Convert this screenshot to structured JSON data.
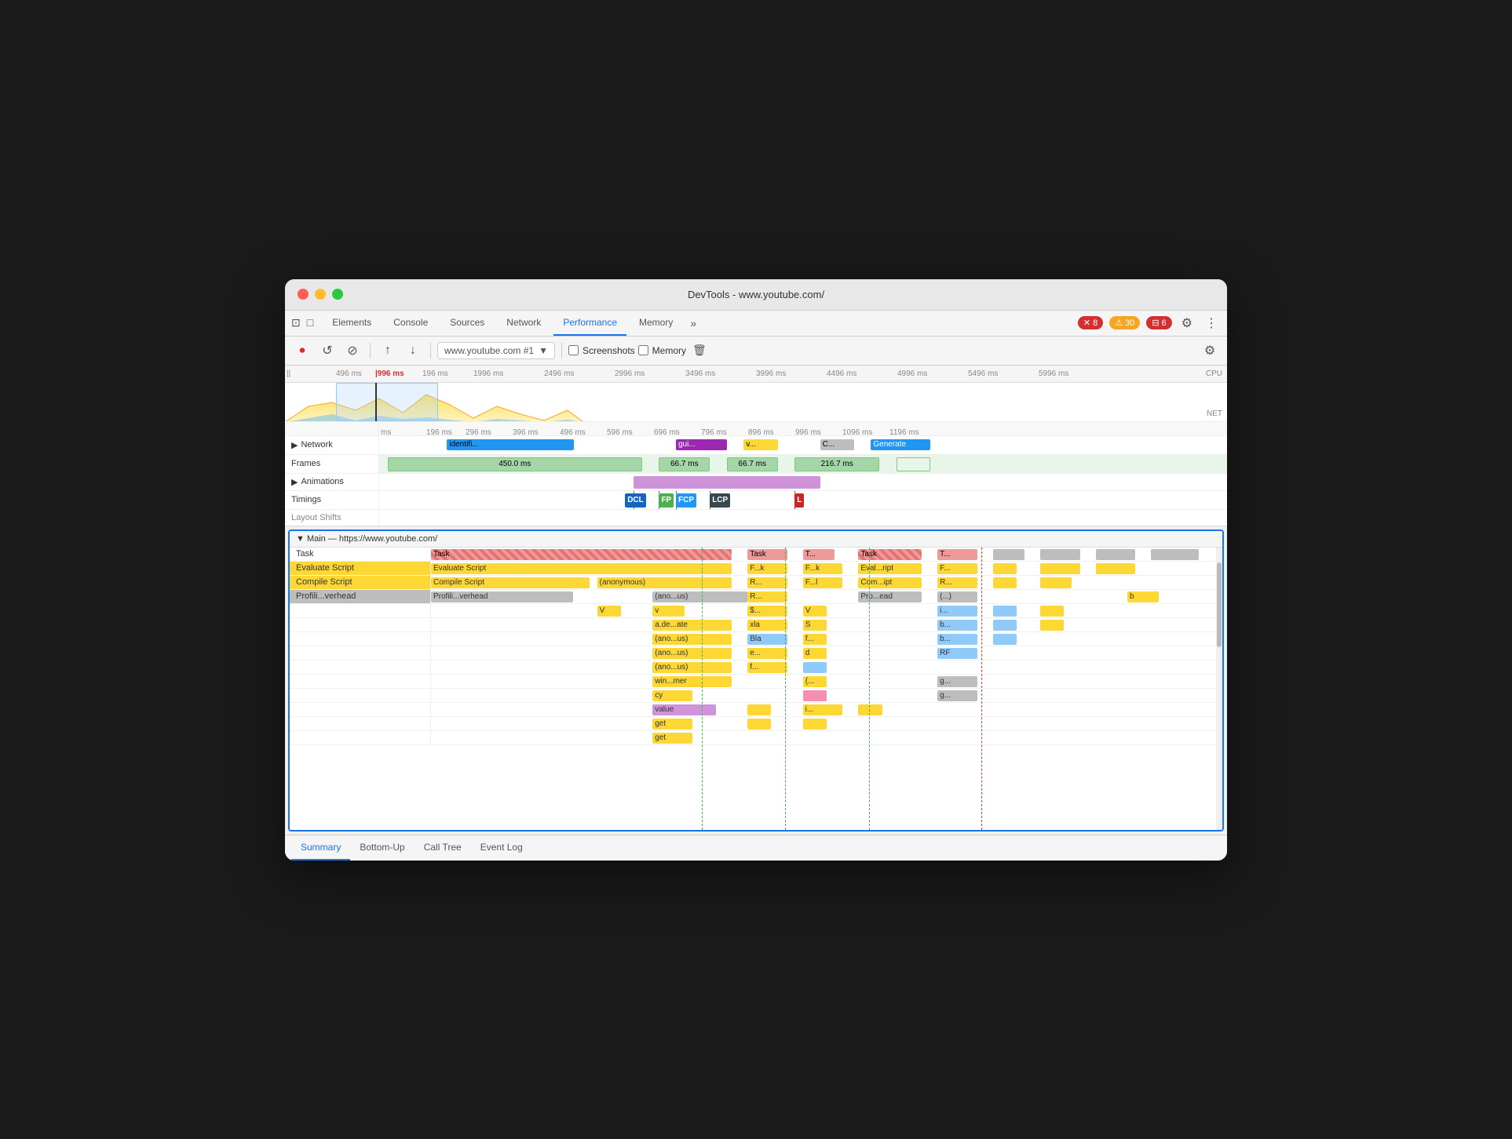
{
  "window": {
    "title": "DevTools - www.youtube.com/"
  },
  "tabs": {
    "items": [
      {
        "label": "Elements",
        "active": false
      },
      {
        "label": "Console",
        "active": false
      },
      {
        "label": "Sources",
        "active": false
      },
      {
        "label": "Network",
        "active": false
      },
      {
        "label": "Performance",
        "active": true
      },
      {
        "label": "Memory",
        "active": false
      }
    ],
    "more": "»",
    "error_count": "8",
    "warn_count": "30",
    "info_count": "6"
  },
  "toolbar": {
    "record_label": "⏺",
    "reload_label": "↺",
    "clear_label": "⊘",
    "upload_label": "↑",
    "download_label": "↓",
    "url_value": "www.youtube.com #1",
    "screenshots_label": "Screenshots",
    "memory_label": "Memory",
    "settings_label": "⚙"
  },
  "timeline": {
    "ruler_marks": [
      "ms",
      "196 ms",
      "1996 ms",
      "196 ms",
      "1996 ms",
      "2496 ms",
      "2996 ms",
      "3496 ms",
      "3996 ms",
      "4496 ms",
      "4996 ms",
      "5496 ms",
      "5996 ms"
    ],
    "ms_marks": [
      "ms",
      "196 ms",
      "296 ms",
      "396 ms",
      "496 ms",
      "596 ms",
      "696 ms",
      "796 ms",
      "896 ms",
      "996 ms",
      "1096 ms",
      "1196 ms"
    ]
  },
  "tracks": {
    "network": {
      "label": "Network",
      "items": [
        {
          "text": "identifi...",
          "color": "blue"
        },
        {
          "text": "gui...",
          "color": "purple"
        },
        {
          "text": "v...",
          "color": "yellow"
        },
        {
          "text": "C...",
          "color": "gray"
        },
        {
          "text": "Generate",
          "color": "blue"
        }
      ]
    },
    "frames": {
      "label": "Frames",
      "items": [
        {
          "text": "450.0 ms",
          "left": "5%",
          "width": "32%"
        },
        {
          "text": "66.7 ms",
          "left": "39%",
          "width": "7%"
        },
        {
          "text": "66.7 ms",
          "left": "47%",
          "width": "7%"
        },
        {
          "text": "216.7 ms",
          "left": "55%",
          "width": "12%"
        }
      ]
    },
    "animations": {
      "label": "Animations",
      "block": {
        "left": "37%",
        "width": "22%",
        "color": "#ce93d8"
      }
    },
    "timings": {
      "label": "Timings",
      "badges": [
        {
          "text": "DCL",
          "left": "37%",
          "class": "badge-dcl"
        },
        {
          "text": "FP",
          "left": "41%",
          "class": "badge-fp"
        },
        {
          "text": "FCP",
          "left": "43%",
          "class": "badge-fcp"
        },
        {
          "text": "LCP",
          "left": "48%",
          "class": "badge-lcp"
        },
        {
          "text": "L",
          "left": "60%",
          "class": "badge-l"
        }
      ]
    }
  },
  "main": {
    "header": "▼ Main — https://www.youtube.com/",
    "rows": [
      {
        "label": "Task",
        "blocks": [
          {
            "text": "Task",
            "left": "0%",
            "width": "38%",
            "class": "flame-task-striped"
          },
          {
            "text": "Task",
            "left": "41%",
            "width": "5%",
            "class": "flame-task"
          },
          {
            "text": "T...",
            "left": "48%",
            "width": "5%",
            "class": "flame-task"
          },
          {
            "text": "Task",
            "left": "55%",
            "width": "8%",
            "class": "flame-task-striped"
          },
          {
            "text": "T...",
            "left": "65%",
            "width": "5%",
            "class": "flame-task"
          },
          {
            "text": "",
            "left": "72%",
            "width": "5%",
            "class": "flame-task"
          },
          {
            "text": "",
            "left": "79%",
            "width": "5%",
            "class": "flame-gray"
          },
          {
            "text": "",
            "left": "86%",
            "width": "5%",
            "class": "flame-gray"
          },
          {
            "text": "",
            "left": "93%",
            "width": "6%",
            "class": "flame-gray"
          }
        ]
      },
      {
        "label": "Evaluate Script",
        "label_color": "#333",
        "bg_color": "#fdd835",
        "blocks": [
          {
            "text": "Evaluate Script",
            "left": "0%",
            "width": "38%",
            "class": "flame-evaluate"
          },
          {
            "text": "F...k",
            "left": "41%",
            "width": "5%",
            "class": "flame-evaluate"
          },
          {
            "text": "F...k",
            "left": "48%",
            "width": "5%",
            "class": "flame-evaluate"
          },
          {
            "text": "Eval...ript",
            "left": "55%",
            "width": "8%",
            "class": "flame-evaluate"
          },
          {
            "text": "F...",
            "left": "65%",
            "width": "5%",
            "class": "flame-evaluate"
          },
          {
            "text": "",
            "left": "72%",
            "width": "3%",
            "class": "flame-evaluate"
          },
          {
            "text": "",
            "left": "79%",
            "width": "5%",
            "class": "flame-evaluate"
          },
          {
            "text": "",
            "left": "86%",
            "width": "5%",
            "class": "flame-evaluate"
          }
        ]
      },
      {
        "label": "Compile Script",
        "sublabel": "(anonymous)",
        "blocks": [
          {
            "text": "Compile Script",
            "left": "0%",
            "width": "20%",
            "class": "flame-evaluate"
          },
          {
            "text": "(anonymous)",
            "left": "20%",
            "width": "18%",
            "class": "flame-evaluate"
          },
          {
            "text": "R...",
            "left": "41%",
            "width": "5%",
            "class": "flame-evaluate"
          },
          {
            "text": "F...l",
            "left": "48%",
            "width": "5%",
            "class": "flame-evaluate"
          },
          {
            "text": "Com...ipt",
            "left": "55%",
            "width": "8%",
            "class": "flame-evaluate"
          },
          {
            "text": "R...",
            "left": "65%",
            "width": "5%",
            "class": "flame-evaluate"
          },
          {
            "text": "",
            "left": "72%",
            "width": "3%",
            "class": "flame-evaluate"
          },
          {
            "text": "",
            "left": "79%",
            "width": "4%",
            "class": "flame-evaluate"
          }
        ]
      },
      {
        "label": "Profili...verhead",
        "sublabel": "(ano...us)",
        "blocks": [
          {
            "text": "Profili...verhead",
            "left": "0%",
            "width": "18%",
            "class": "flame-profile"
          },
          {
            "text": "(ano...us)",
            "left": "28%",
            "width": "12%",
            "class": "flame-profile"
          },
          {
            "text": "R...",
            "left": "41%",
            "width": "5%",
            "class": "flame-yellow"
          },
          {
            "text": "",
            "left": "48%",
            "width": "3%",
            "class": "flame-yellow"
          },
          {
            "text": "Pro...ead",
            "left": "55%",
            "width": "8%",
            "class": "flame-profile"
          },
          {
            "text": "(...)",
            "left": "65%",
            "width": "5%",
            "class": "flame-profile"
          },
          {
            "text": "b",
            "left": "88%",
            "width": "4%",
            "class": "flame-yellow"
          }
        ]
      },
      {
        "label": "",
        "blocks": [
          {
            "text": "V",
            "left": "22%",
            "width": "3%",
            "class": "flame-yellow"
          },
          {
            "text": "v",
            "left": "28%",
            "width": "4%",
            "class": "flame-yellow"
          },
          {
            "text": "$...",
            "left": "41%",
            "width": "5%",
            "class": "flame-yellow"
          },
          {
            "text": "V",
            "left": "48%",
            "width": "3%",
            "class": "flame-yellow"
          },
          {
            "text": "i...",
            "left": "65%",
            "width": "5%",
            "class": "flame-blue"
          },
          {
            "text": "",
            "left": "72%",
            "width": "3%",
            "class": "flame-blue"
          },
          {
            "text": "",
            "left": "79%",
            "width": "3%",
            "class": "flame-yellow"
          }
        ]
      },
      {
        "label": "",
        "blocks": [
          {
            "text": "a.de...ate",
            "left": "28%",
            "width": "10%",
            "class": "flame-yellow"
          },
          {
            "text": "xla",
            "left": "41%",
            "width": "5%",
            "class": "flame-yellow"
          },
          {
            "text": "S",
            "left": "48%",
            "width": "3%",
            "class": "flame-yellow"
          },
          {
            "text": "b...",
            "left": "65%",
            "width": "5%",
            "class": "flame-blue"
          },
          {
            "text": "",
            "left": "72%",
            "width": "3%",
            "class": "flame-blue"
          },
          {
            "text": "",
            "left": "79%",
            "width": "3%",
            "class": "flame-yellow"
          }
        ]
      },
      {
        "label": "",
        "blocks": [
          {
            "text": "(ano...us)",
            "left": "28%",
            "width": "10%",
            "class": "flame-yellow"
          },
          {
            "text": "Bla",
            "left": "41%",
            "width": "5%",
            "class": "flame-blue"
          },
          {
            "text": "f...",
            "left": "48%",
            "width": "3%",
            "class": "flame-yellow"
          },
          {
            "text": "b...",
            "left": "65%",
            "width": "5%",
            "class": "flame-blue"
          },
          {
            "text": "",
            "left": "72%",
            "width": "3%",
            "class": "flame-blue"
          }
        ]
      },
      {
        "label": "",
        "blocks": [
          {
            "text": "(ano...us)",
            "left": "28%",
            "width": "10%",
            "class": "flame-yellow"
          },
          {
            "text": "e...",
            "left": "41%",
            "width": "5%",
            "class": "flame-yellow"
          },
          {
            "text": "d",
            "left": "48%",
            "width": "3%",
            "class": "flame-yellow"
          },
          {
            "text": "RF",
            "left": "65%",
            "width": "5%",
            "class": "flame-blue"
          }
        ]
      },
      {
        "label": "",
        "blocks": [
          {
            "text": "(ano...us)",
            "left": "28%",
            "width": "10%",
            "class": "flame-yellow"
          },
          {
            "text": "f...",
            "left": "41%",
            "width": "5%",
            "class": "flame-yellow"
          },
          {
            "text": "",
            "left": "48%",
            "width": "3%",
            "class": "flame-blue"
          }
        ]
      },
      {
        "label": "",
        "blocks": [
          {
            "text": "win...mer",
            "left": "28%",
            "width": "10%",
            "class": "flame-yellow"
          },
          {
            "text": "(...",
            "left": "48%",
            "width": "3%",
            "class": "flame-yellow"
          },
          {
            "text": "g...",
            "left": "65%",
            "width": "5%",
            "class": "flame-gray"
          }
        ]
      },
      {
        "label": "",
        "blocks": [
          {
            "text": "cy",
            "left": "28%",
            "width": "5%",
            "class": "flame-yellow"
          },
          {
            "text": "",
            "left": "48%",
            "width": "3%",
            "class": "flame-pink"
          },
          {
            "text": "g...",
            "left": "65%",
            "width": "5%",
            "class": "flame-gray"
          }
        ]
      },
      {
        "label": "",
        "blocks": [
          {
            "text": "value",
            "left": "28%",
            "width": "8%",
            "class": "flame-purple"
          },
          {
            "text": "",
            "left": "41%",
            "width": "3%",
            "class": "flame-yellow"
          },
          {
            "text": "i...",
            "left": "48%",
            "width": "5%",
            "class": "flame-yellow"
          },
          {
            "text": "",
            "left": "55%",
            "width": "3%",
            "class": "flame-yellow"
          }
        ]
      },
      {
        "label": "",
        "blocks": [
          {
            "text": "get",
            "left": "28%",
            "width": "5%",
            "class": "flame-yellow"
          },
          {
            "text": "",
            "left": "41%",
            "width": "3%",
            "class": "flame-yellow"
          },
          {
            "text": "",
            "left": "48%",
            "width": "3%",
            "class": "flame-yellow"
          }
        ]
      },
      {
        "label": "",
        "blocks": [
          {
            "text": "get",
            "left": "28%",
            "width": "5%",
            "class": "flame-yellow"
          }
        ]
      }
    ]
  },
  "bottom_tabs": [
    {
      "label": "Summary",
      "active": true
    },
    {
      "label": "Bottom-Up",
      "active": false
    },
    {
      "label": "Call Tree",
      "active": false
    },
    {
      "label": "Event Log",
      "active": false
    }
  ]
}
